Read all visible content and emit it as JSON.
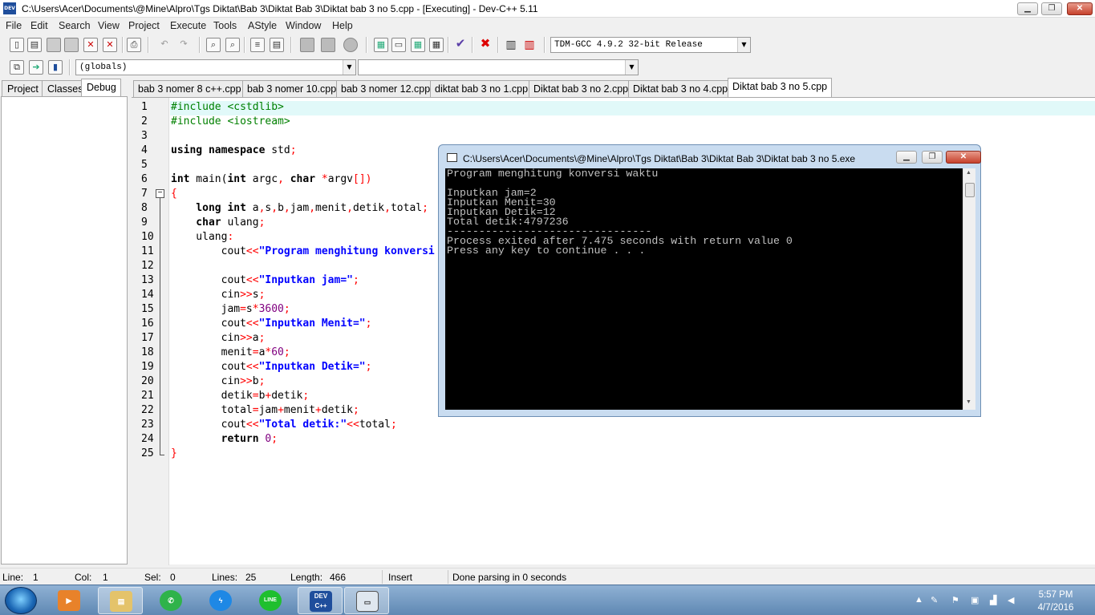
{
  "window": {
    "app_icon_label": "DEV",
    "title": "C:\\Users\\Acer\\Documents\\@Mine\\Alpro\\Tgs Diktat\\Bab 3\\Diktat Bab 3\\Diktat bab 3 no 5.cpp - [Executing] - Dev-C++ 5.11",
    "minimize": "▁",
    "maximize": "❐",
    "close": "✕"
  },
  "menu": [
    "File",
    "Edit",
    "Search",
    "View",
    "Project",
    "Execute",
    "Tools",
    "AStyle",
    "Window",
    "Help"
  ],
  "toolbar": {
    "compiler": "TDM-GCC 4.9.2 32-bit Release",
    "scope": "(globals)",
    "member": ""
  },
  "left_tabs": [
    "Project",
    "Classes",
    "Debug"
  ],
  "editor_tabs": [
    "bab 3 nomer 8 c++.cpp",
    "bab 3 nomer 10.cpp",
    "bab 3 nomer 12.cpp",
    "diktat bab 3 no 1.cpp",
    "Diktat bab 3 no 2.cpp",
    "Diktat bab 3 no 4.cpp",
    "Diktat bab 3 no 5.cpp"
  ],
  "line_numbers": [
    "1",
    "2",
    "3",
    "4",
    "5",
    "6",
    "7",
    "8",
    "9",
    "10",
    "11",
    "12",
    "13",
    "14",
    "15",
    "16",
    "17",
    "18",
    "19",
    "20",
    "21",
    "22",
    "23",
    "24",
    "25"
  ],
  "code": {
    "l1": "#include <cstdlib>",
    "l2": "#include <iostream>",
    "l4a": "using namespace",
    "l4b": " std",
    "l4c": ";",
    "l6a": "int",
    "l6b": " main(",
    "l6c": "int",
    "l6d": " argc",
    "l6e": ",",
    "l6f": " char",
    "l6g": " *",
    "l6h": "argv",
    "l6i": "[])",
    "l7": "{",
    "l8a": "    long int",
    "l8b": " a",
    "l8c": ",",
    "l8d": "s",
    "l8e": ",",
    "l8f": "b",
    "l8g": ",",
    "l8h": "jam",
    "l8i": ",",
    "l8j": "menit",
    "l8k": ",",
    "l8l": "detik",
    "l8m": ",",
    "l8n": "total",
    "l8o": ";",
    "l9a": "    char",
    "l9b": " ulang",
    "l9c": ";",
    "l10a": "    ulang",
    "l10b": ":",
    "l11a": "        cout",
    "l11b": "<<",
    "l11c": "\"Program menghitung konversi waktu\"",
    "l13a": "        cout",
    "l13b": "<<",
    "l13c": "\"Inputkan jam=\"",
    "l13d": ";",
    "l14a": "        cin",
    "l14b": ">>",
    "l14c": "s",
    "l14d": ";",
    "l15a": "        jam",
    "l15b": "=",
    "l15c": "s",
    "l15d": "*",
    "l15e": "3600",
    "l15f": ";",
    "l16a": "        cout",
    "l16b": "<<",
    "l16c": "\"Inputkan Menit=\"",
    "l16d": ";",
    "l17a": "        cin",
    "l17b": ">>",
    "l17c": "a",
    "l17d": ";",
    "l18a": "        menit",
    "l18b": "=",
    "l18c": "a",
    "l18d": "*",
    "l18e": "60",
    "l18f": ";",
    "l19a": "        cout",
    "l19b": "<<",
    "l19c": "\"Inputkan Detik=\"",
    "l19d": ";",
    "l20a": "        cin",
    "l20b": ">>",
    "l20c": "b",
    "l20d": ";",
    "l21a": "        detik",
    "l21b": "=",
    "l21c": "b",
    "l21d": "+",
    "l21e": "detik",
    "l21f": ";",
    "l22a": "        total",
    "l22b": "=",
    "l22c": "jam",
    "l22d": "+",
    "l22e": "menit",
    "l22f": "+",
    "l22g": "detik",
    "l22h": ";",
    "l23a": "        cout",
    "l23b": "<<",
    "l23c": "\"Total detik:\"",
    "l23d": "<<",
    "l23e": "total",
    "l23f": ";",
    "l24a": "        return",
    "l24b": " 0",
    "l24c": ";",
    "l25": "}"
  },
  "console": {
    "title": "C:\\Users\\Acer\\Documents\\@Mine\\Alpro\\Tgs Diktat\\Bab 3\\Diktat Bab 3\\Diktat bab 3 no 5.exe",
    "output": "Program menghitung konversi waktu\n\nInputkan jam=2\nInputkan Menit=30\nInputkan Detik=12\nTotal detik:4797236\n--------------------------------\nProcess exited after 7.475 seconds with return value 0\nPress any key to continue . . ."
  },
  "status": {
    "line_label": "Line:",
    "line_value": "1",
    "col_label": "Col:",
    "col_value": "1",
    "sel_label": "Sel:",
    "sel_value": "0",
    "lines_label": "Lines:",
    "lines_value": "25",
    "length_label": "Length:",
    "length_value": "466",
    "mode": "Insert",
    "message": "Done parsing in 0 seconds"
  },
  "taskbar": {
    "devcpp_label": "DEV C++",
    "time": "5:57 PM",
    "date": "4/7/2016"
  },
  "colors": {
    "preprocessor": "#008000",
    "string": "#0000ff",
    "operator": "#ff0000",
    "number": "#800080",
    "active_line": "#e1f9f9"
  }
}
